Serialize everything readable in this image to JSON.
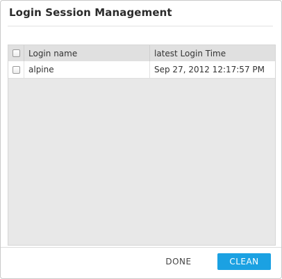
{
  "dialog": {
    "title": "Login Session Management"
  },
  "table": {
    "columns": [
      "Login name",
      "latest Login Time"
    ],
    "rows": [
      {
        "login_name": "alpine",
        "latest_login_time": "Sep 27, 2012 12:17:57 PM"
      }
    ]
  },
  "footer": {
    "done_label": "DONE",
    "clean_label": "CLEAN"
  },
  "colors": {
    "accent": "#1ba1e2",
    "panel": "#e8e8e8"
  }
}
